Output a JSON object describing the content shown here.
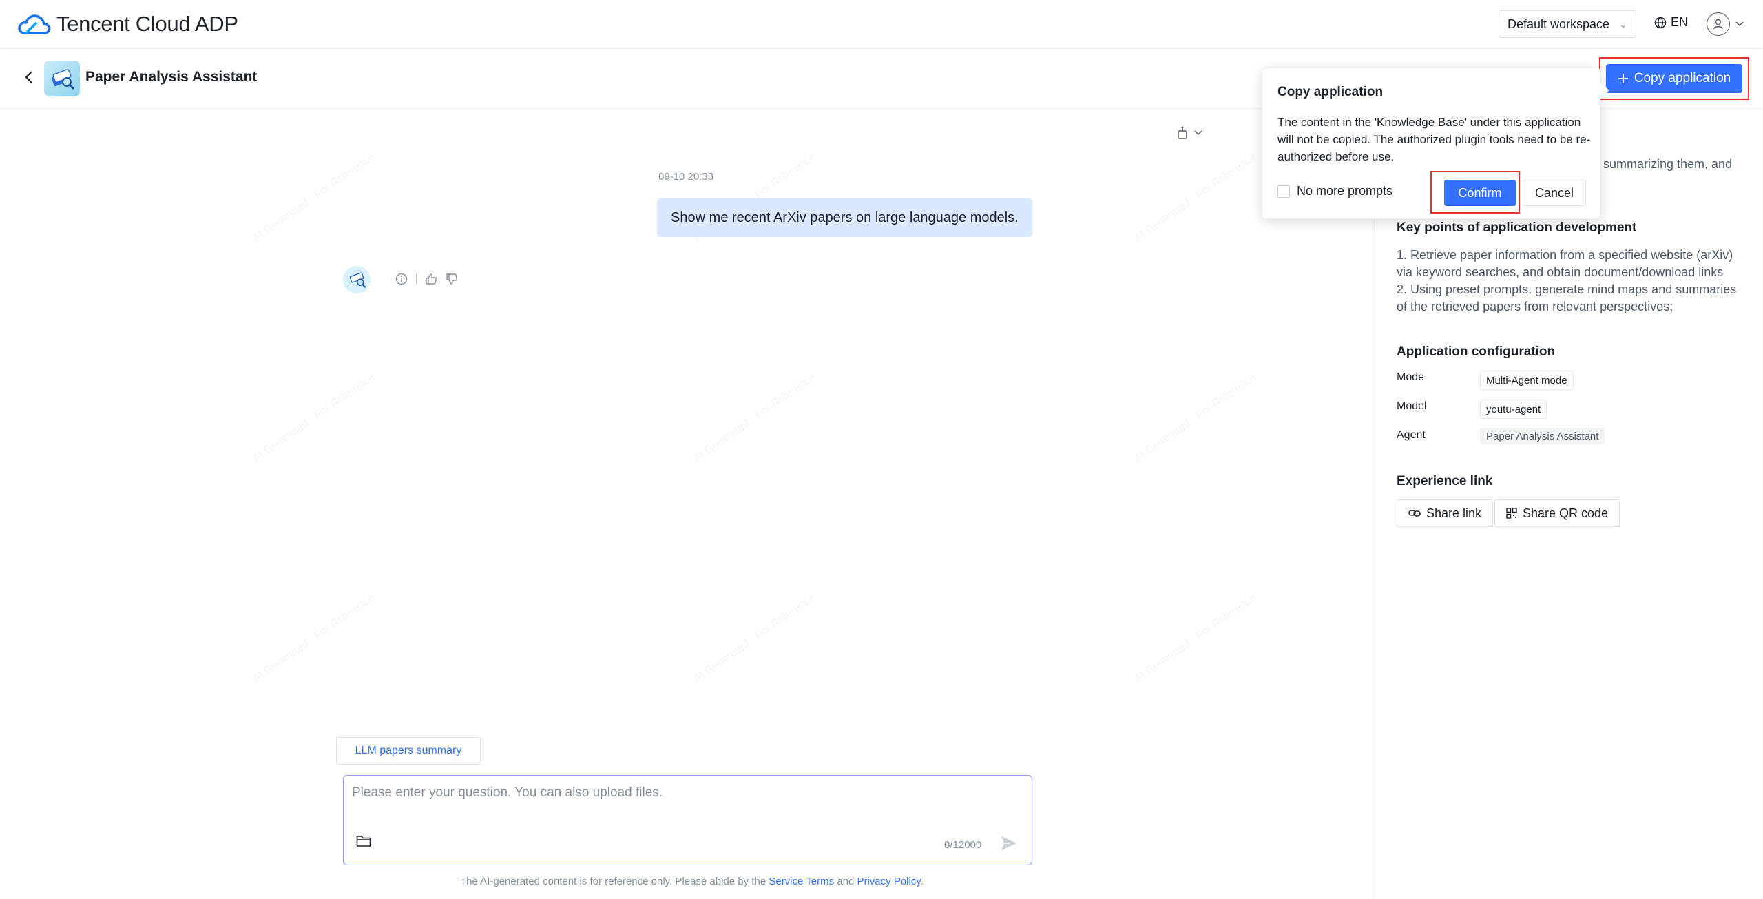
{
  "nav": {
    "logo_text": "Tencent Cloud ADP",
    "workspace": "Default workspace",
    "language": "EN"
  },
  "app": {
    "title": "Paper Analysis Assistant",
    "copy_button": "Copy application"
  },
  "chat": {
    "timestamp": "09-10 20:33",
    "user_message": "Show me recent ArXiv papers on large language models.",
    "suggestion": "LLM papers summary",
    "input_placeholder": "Please enter your question. You can also upload files.",
    "counter": "0/12000",
    "disclaimer_prefix": "The AI-generated content is for reference only. Please abide by the ",
    "service_terms": "Service Terms",
    "disclaimer_and": " and ",
    "privacy_policy": "Privacy Policy",
    "disclaimer_suffix": ".",
    "watermark": "AI Generated · For Reference"
  },
  "panel": {
    "intro_tail": "summarizing them, and",
    "key_points_title": "Key points of application development",
    "key_points": [
      "1. Retrieve paper information from a specified website (arXiv) via keyword searches, and obtain document/download links",
      "2. Using preset prompts, generate mind maps and summaries of the retrieved papers from relevant perspectives;"
    ],
    "config_title": "Application configuration",
    "mode_label": "Mode",
    "mode_value": "Multi-Agent mode",
    "model_label": "Model",
    "model_value": "youtu-agent",
    "agent_label": "Agent",
    "agent_value": "Paper Analysis Assistant",
    "experience_title": "Experience link",
    "share_link": "Share link",
    "share_qr": "Share QR code"
  },
  "popover": {
    "title": "Copy application",
    "body": "The content in the 'Knowledge Base' under this application will not be copied. The authorized plugin tools need to be re-authorized before use.",
    "checkbox": "No more prompts",
    "confirm": "Confirm",
    "cancel": "Cancel"
  },
  "colors": {
    "primary": "#3370ff",
    "highlight": "#e8312f",
    "user_bubble": "#dce8ff"
  }
}
